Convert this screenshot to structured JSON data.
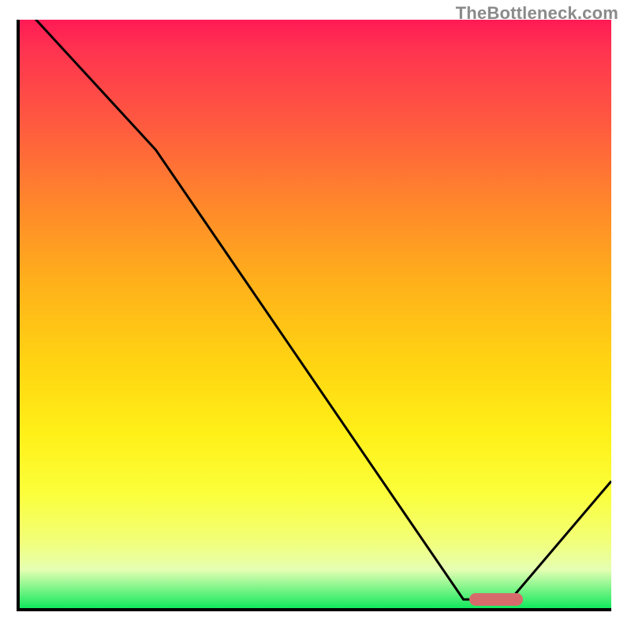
{
  "watermark": "TheBottleneck.com",
  "chart_data": {
    "type": "line",
    "title": "",
    "xlabel": "",
    "ylabel": "",
    "xlim": [
      0,
      100
    ],
    "ylim": [
      0,
      100
    ],
    "series": [
      {
        "name": "curve",
        "x": [
          0,
          23,
          75,
          83,
          100
        ],
        "y": [
          103,
          78,
          2,
          2,
          22
        ]
      }
    ],
    "marker": {
      "x_start": 76,
      "x_end": 85,
      "y": 2
    },
    "gradient_stops": [
      {
        "pos": 0,
        "color": "#ff1a55"
      },
      {
        "pos": 5,
        "color": "#ff3350"
      },
      {
        "pos": 18,
        "color": "#ff5b3f"
      },
      {
        "pos": 32,
        "color": "#ff8a2a"
      },
      {
        "pos": 45,
        "color": "#ffb21a"
      },
      {
        "pos": 58,
        "color": "#ffd412"
      },
      {
        "pos": 70,
        "color": "#fff018"
      },
      {
        "pos": 80,
        "color": "#fbff3a"
      },
      {
        "pos": 88,
        "color": "#f2ff77"
      },
      {
        "pos": 93,
        "color": "#e5ffb3"
      },
      {
        "pos": 100,
        "color": "#00e756"
      }
    ]
  }
}
